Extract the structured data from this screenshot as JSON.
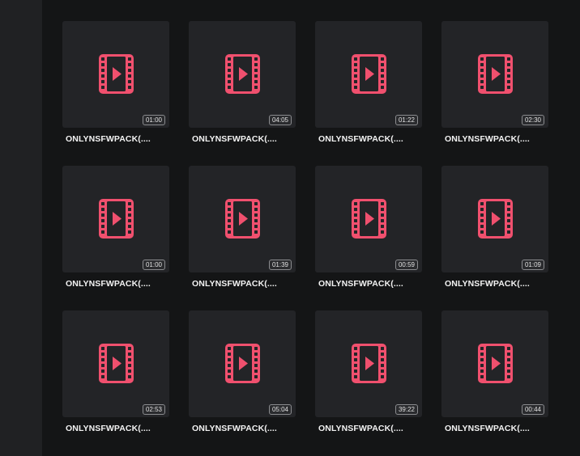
{
  "colors": {
    "background": "#141516",
    "sidebar": "#202123",
    "tile": "#232427",
    "accent": "#f0506e",
    "text": "#f2f2f2"
  },
  "icon": "film-play-icon",
  "videos": [
    {
      "title": "ONLYNSFWPACK(....",
      "duration": "01:00"
    },
    {
      "title": "ONLYNSFWPACK(....",
      "duration": "04:05"
    },
    {
      "title": "ONLYNSFWPACK(....",
      "duration": "01:22"
    },
    {
      "title": "ONLYNSFWPACK(....",
      "duration": "02:30"
    },
    {
      "title": "ONLYNSFWPACK(....",
      "duration": "01:00"
    },
    {
      "title": "ONLYNSFWPACK(....",
      "duration": "01:39"
    },
    {
      "title": "ONLYNSFWPACK(....",
      "duration": "00:59"
    },
    {
      "title": "ONLYNSFWPACK(....",
      "duration": "01:09"
    },
    {
      "title": "ONLYNSFWPACK(....",
      "duration": "02:53"
    },
    {
      "title": "ONLYNSFWPACK(....",
      "duration": "05:04"
    },
    {
      "title": "ONLYNSFWPACK(....",
      "duration": "39:22"
    },
    {
      "title": "ONLYNSFWPACK(....",
      "duration": "00:44"
    }
  ]
}
